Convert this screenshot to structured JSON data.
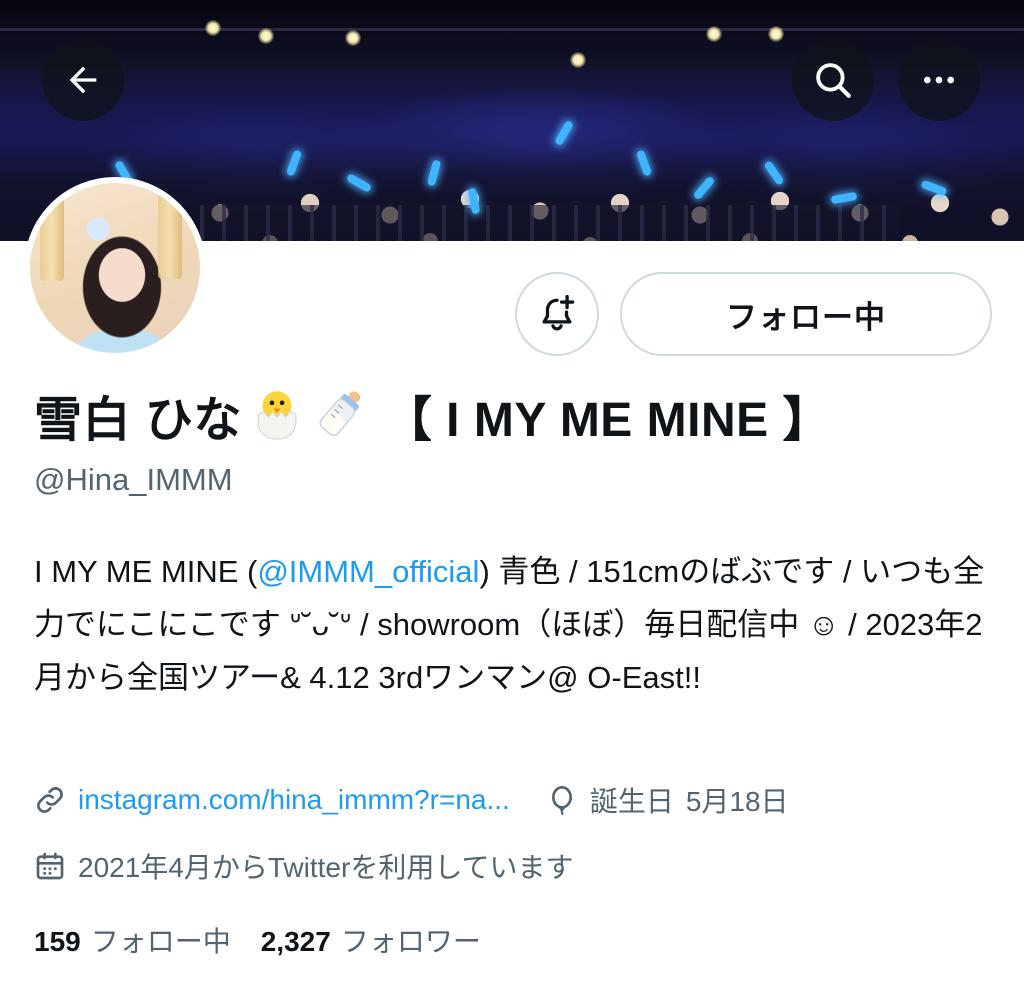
{
  "nav": {
    "back_icon": "arrow-left-icon",
    "search_icon": "search-icon",
    "more_icon": "more-horizontal-icon"
  },
  "profile": {
    "display_name": "雪白 ひな",
    "emoji": [
      "hatching-chick-emoji",
      "baby-bottle-emoji"
    ],
    "group_name": "【 I MY ME MINE 】",
    "handle": "@Hina_IMMM",
    "follow_button_label": "フォロー中",
    "bell_icon": "bell-plus-icon"
  },
  "bio": {
    "prefix": "I MY ME MINE (",
    "mention": "@IMMM_official",
    "suffix": ") 青色 / 151cmのばぶです / いつも全力でにこにこです ᐡ˘ᴗ˘ᐡ / showroom（ほぼ）毎日配信中 ☺︎ / 2023年2月から全国ツアー& 4.12 3rdワンマン@ O-East!!"
  },
  "meta": {
    "link_icon": "link-icon",
    "link_text": "instagram.com/hina_immm?r=na...",
    "birthday_icon": "balloon-icon",
    "birthday_label": "誕生日",
    "birthday_value": "5月18日",
    "calendar_icon": "calendar-icon",
    "joined_text": "2021年4月からTwitterを利用しています"
  },
  "stats": {
    "following_count": "159",
    "following_label": "フォロー中",
    "followers_count": "2,327",
    "followers_label": "フォロワー"
  },
  "colors": {
    "accent": "#1d9bf0",
    "text_primary": "#0f1419",
    "text_secondary": "#536471",
    "border": "#cfd9de"
  }
}
